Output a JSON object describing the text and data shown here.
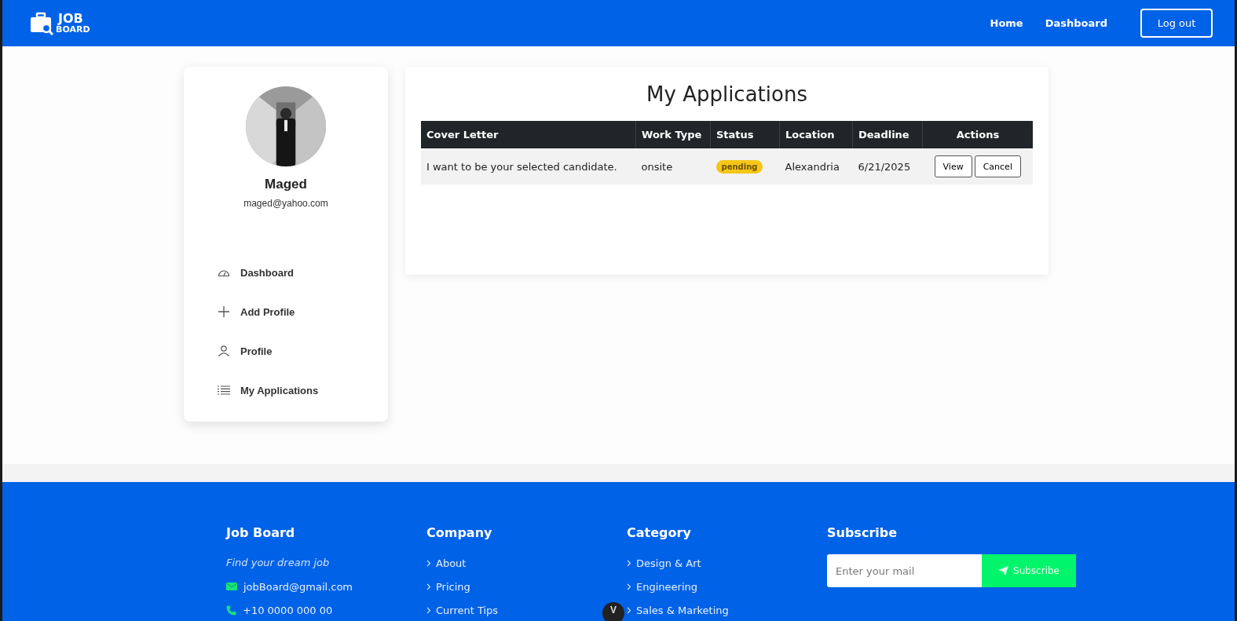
{
  "header": {
    "logo": {
      "line1": "JOB",
      "line2": "BOARD"
    },
    "nav": [
      "Home",
      "Dashboard"
    ],
    "logout": "Log out"
  },
  "profile": {
    "name": "Maged",
    "email": "maged@yahoo.com"
  },
  "sidebar": {
    "items": [
      {
        "label": "Dashboard"
      },
      {
        "label": "Add Profile"
      },
      {
        "label": "Profile"
      },
      {
        "label": "My Applications"
      }
    ]
  },
  "applications": {
    "title": "My Applications",
    "columns": [
      "Cover Letter",
      "Work Type",
      "Status",
      "Location",
      "Deadline",
      "Actions"
    ],
    "rows": [
      {
        "cover_letter": "I want to be your selected candidate.",
        "work_type": "onsite",
        "status": {
          "label": "pending",
          "color": "#f5c518"
        },
        "location": "Alexandria",
        "deadline": "6/21/2025",
        "actions": [
          "View",
          "Cancel"
        ]
      }
    ]
  },
  "footer": {
    "about": {
      "title": "Job Board",
      "tagline": "Find your dream job",
      "email": "jobBoard@gmail.com",
      "phone": "+10 0000 000 00"
    },
    "company": {
      "title": "Company",
      "links": [
        "About",
        "Pricing",
        "Current Tips"
      ]
    },
    "category": {
      "title": "Category",
      "links": [
        "Design & Art",
        "Engineering",
        "Sales & Marketing"
      ]
    },
    "subscribe": {
      "title": "Subscribe",
      "placeholder": "Enter your mail",
      "button": "Subscribe"
    },
    "devtools_badge": "V"
  }
}
